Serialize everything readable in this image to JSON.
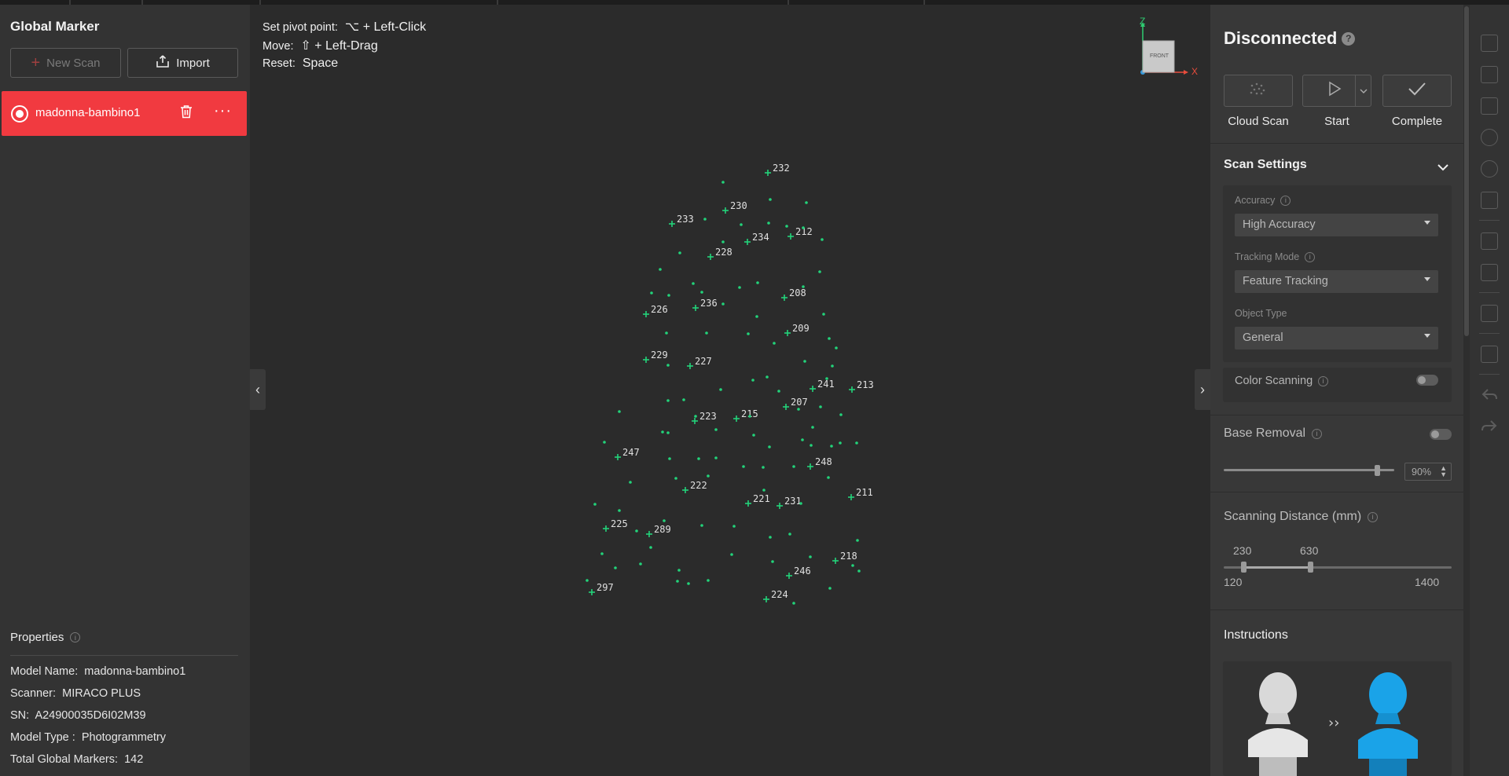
{
  "left_panel": {
    "title": "Global Marker",
    "new_scan_label": "New Scan",
    "import_label": "Import",
    "scan_item_name": "madonna-bambino1",
    "more_label": "···",
    "properties_label": "Properties",
    "properties": [
      {
        "key": "Model Name:",
        "value": "madonna-bambino1"
      },
      {
        "key": "Scanner:",
        "value": "MIRACO PLUS"
      },
      {
        "key": "SN:",
        "value": "A24900035D6I02M39"
      },
      {
        "key": "Model Type :",
        "value": "Photogrammetry"
      },
      {
        "key": "Total Global Markers:",
        "value": "142"
      }
    ]
  },
  "viewport": {
    "help": [
      {
        "key": "Set pivot point:",
        "value": "⌥ + Left-Click"
      },
      {
        "key": "Move:",
        "value": "⇧ + Left-Drag"
      },
      {
        "key": "Reset:",
        "value": "Space"
      }
    ],
    "gizmo": {
      "z_label": "Z",
      "x_label": "X",
      "face_label": "FRONT"
    },
    "marker_color": "#22d37a",
    "labeled_markers": [
      {
        "id": "232"
      },
      {
        "id": "230"
      },
      {
        "id": "233"
      },
      {
        "id": "234"
      },
      {
        "id": "212"
      },
      {
        "id": "228"
      },
      {
        "id": "208"
      },
      {
        "id": "226"
      },
      {
        "id": "236"
      },
      {
        "id": "209"
      },
      {
        "id": "229"
      },
      {
        "id": "227"
      },
      {
        "id": "241"
      },
      {
        "id": "213"
      },
      {
        "id": "207"
      },
      {
        "id": "223"
      },
      {
        "id": "215"
      },
      {
        "id": "247"
      },
      {
        "id": "248"
      },
      {
        "id": "222"
      },
      {
        "id": "221"
      },
      {
        "id": "231"
      },
      {
        "id": "211"
      },
      {
        "id": "225"
      },
      {
        "id": "289"
      },
      {
        "id": "218"
      },
      {
        "id": "246"
      },
      {
        "id": "297"
      },
      {
        "id": "224"
      }
    ]
  },
  "right_panel": {
    "status": "Disconnected",
    "help_mark": "?",
    "actions": [
      {
        "label": "Cloud Scan"
      },
      {
        "label": "Start"
      },
      {
        "label": "Complete"
      }
    ],
    "scan_settings": {
      "title": "Scan Settings",
      "accuracy_label": "Accuracy",
      "accuracy_value": "High Accuracy",
      "tracking_label": "Tracking Mode",
      "tracking_value": "Feature Tracking",
      "object_label": "Object Type",
      "object_value": "General",
      "color_scanning_label": "Color Scanning",
      "color_scanning_on": false
    },
    "base_removal": {
      "title": "Base Removal",
      "enabled": false,
      "percent": "90%",
      "level": 0.9
    },
    "scanning_distance": {
      "title": "Scanning Distance (mm)",
      "low_value": "230",
      "high_value": "630",
      "min": "120",
      "max": "1400"
    },
    "instructions_title": "Instructions"
  },
  "colors": {
    "accent_red": "#f13a40",
    "marker_green": "#22d37a",
    "instruction_blue": "#1aa3e8"
  }
}
